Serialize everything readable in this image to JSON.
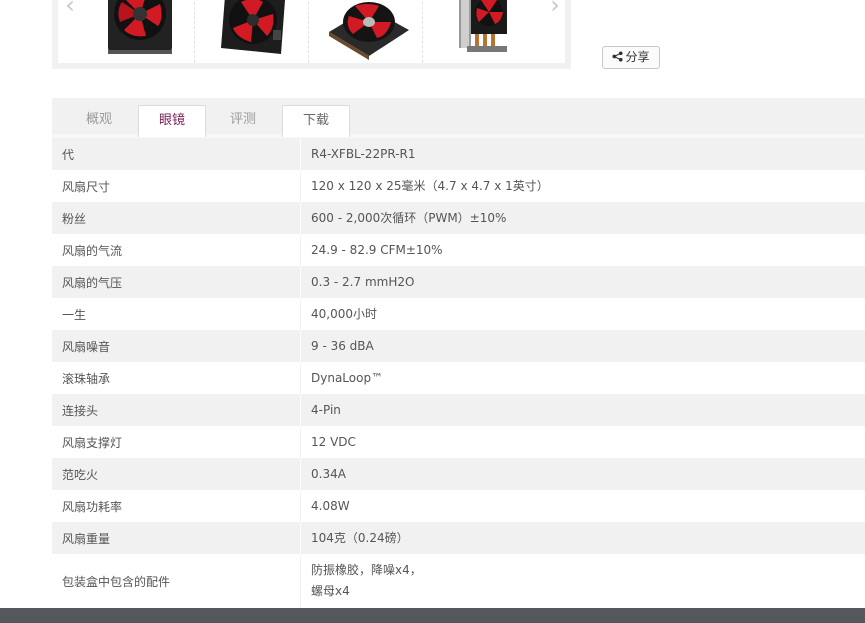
{
  "colors": {
    "active_tab": "#7a1f58",
    "stripe": "#f1f1f1",
    "footer": "#54575c",
    "fan_red": "#d21a25"
  },
  "gallery": {
    "prev_icon": "chevron-left-icon",
    "next_icon": "chevron-right-icon",
    "prev_glyph": "‹",
    "next_glyph": "›"
  },
  "share": {
    "label": "分享",
    "icon": "share-icon"
  },
  "tabs": [
    {
      "label": "概观"
    },
    {
      "label": "眼镜"
    },
    {
      "label": "评测"
    },
    {
      "label": "下载"
    }
  ],
  "specs": [
    {
      "label": "代",
      "value": "R4-XFBL-22PR-R1"
    },
    {
      "label": "风扇尺寸",
      "value": "120 x 120 x 25毫米（4.7 x 4.7 x 1英寸）"
    },
    {
      "label": "粉丝",
      "value": "600 - 2,000次循环（PWM）±10%"
    },
    {
      "label": "风扇的气流",
      "value": "24.9 - 82.9 CFM±10%"
    },
    {
      "label": "风扇的气压",
      "value": "0.3 - 2.7 mmH2O"
    },
    {
      "label": "一生",
      "value": "40,000小时"
    },
    {
      "label": "风扇噪音",
      "value": "9 - 36 dBA"
    },
    {
      "label": "滚珠轴承",
      "value": "DynaLoop™"
    },
    {
      "label": "连接头",
      "value": "4-Pin"
    },
    {
      "label": "风扇支撑灯",
      "value": "12 VDC"
    },
    {
      "label": "范吃火",
      "value": "0.34A"
    },
    {
      "label": "风扇功耗率",
      "value": "4.08W"
    },
    {
      "label": "风扇重量",
      "value": "104克（0.24磅）"
    },
    {
      "label": "包装盒中包含的配件",
      "value": "防振橡胶，降噪x4，\n螺母x4"
    }
  ]
}
